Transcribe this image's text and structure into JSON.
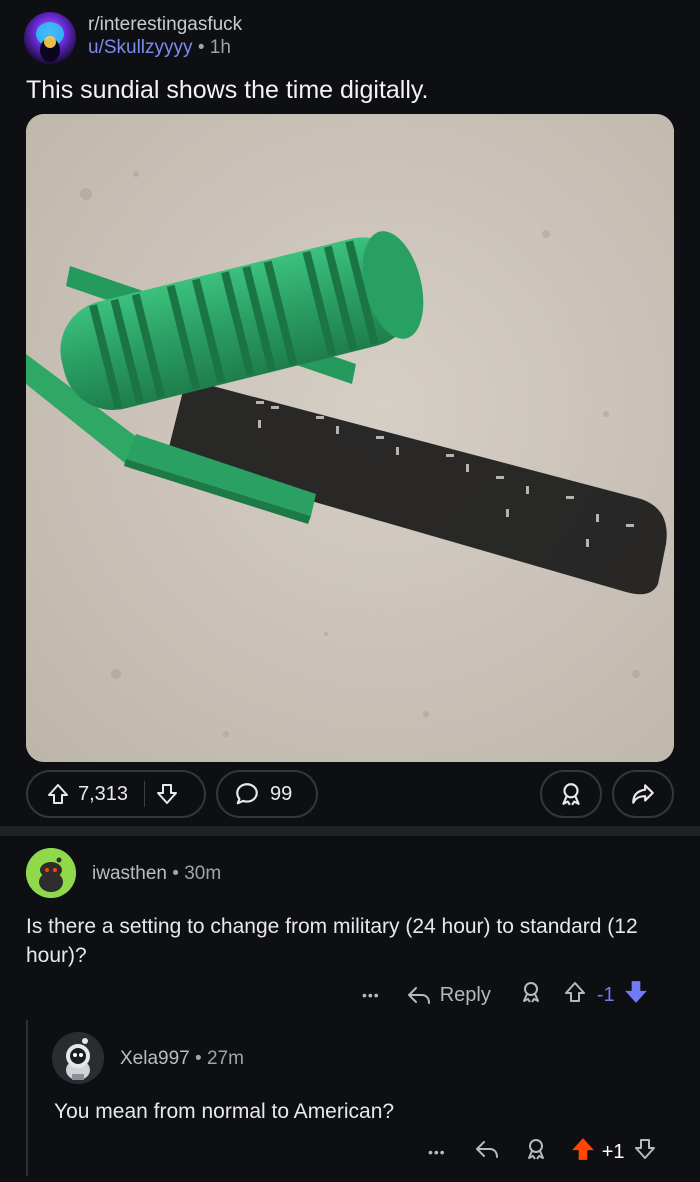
{
  "post": {
    "subreddit": "r/interestingasfuck",
    "author": "u/Skullzyyyy",
    "separator": "•",
    "age": "1h",
    "title": "This sundial shows the time digitally.",
    "upvotes": "7,313",
    "comments": "99"
  },
  "comments": [
    {
      "author": "iwasthen",
      "separator": "•",
      "age": "30m",
      "body": "Is there a setting to change from military (24 hour) to standard (12 hour)?",
      "more": "•••",
      "reply_label": "Reply",
      "score": "-1"
    },
    {
      "author": "Xela997",
      "separator": "•",
      "age": "27m",
      "body": "You mean from normal to American?",
      "more": "•••",
      "score": "+1"
    }
  ],
  "colors": {
    "background": "#0e0f12",
    "downvote_active": "#6f7cf4",
    "upvote_active": "#ff4500",
    "sundial_green": "#2fa866"
  }
}
